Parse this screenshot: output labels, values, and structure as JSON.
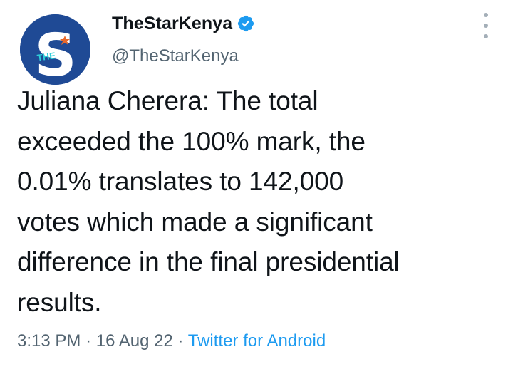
{
  "author": {
    "display_name": "TheStarKenya",
    "handle": "@TheStarKenya",
    "verified_icon": "verified-badge-icon",
    "avatar": {
      "letter": "S",
      "text": "THE",
      "bg_color": "#1f4a95",
      "accent_color": "#2ecfd8",
      "star_color": "#e8682b"
    }
  },
  "tweet": {
    "text": "Juliana Cherera: The total\nexceeded the 100% mark,  the\n0.01% translates to 142,000\nvotes which made a significant\ndifference in the final presidential\nresults.",
    "time": "3:13 PM",
    "date": "16 Aug 22",
    "separator": "·",
    "source": "Twitter for Android"
  },
  "colors": {
    "primary_text": "#0f1419",
    "secondary_text": "#536471",
    "link": "#1d9bf0"
  },
  "icons": {
    "more": "more-vertical-icon"
  }
}
